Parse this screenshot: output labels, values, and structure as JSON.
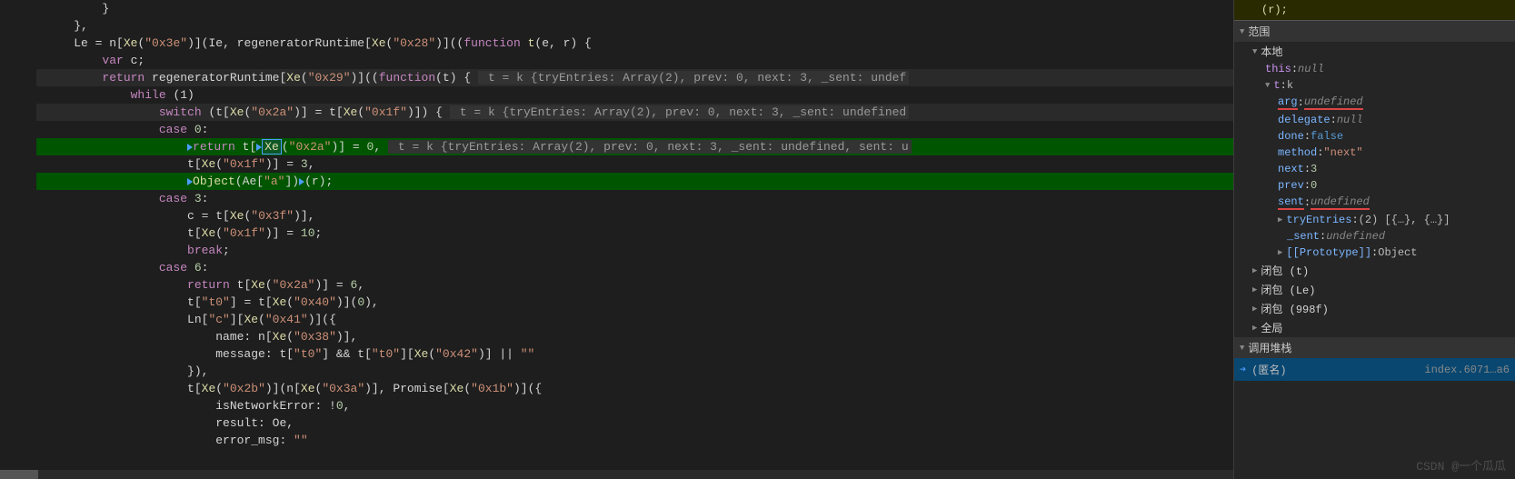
{
  "code": {
    "l0": "        }",
    "l1": "    },",
    "l2_pre": "    Le = n[",
    "l2_xe1": "Xe",
    "l2_s1": "\"0x3e\"",
    "l2_mid": ")](Ie, regeneratorRuntime[",
    "l2_xe2": "Xe",
    "l2_s2": "\"0x28\"",
    "l2_post": ")]((",
    "l2_fn": "function",
    "l2_fnname": " t",
    "l2_params": "(e, r) {",
    "l3_pre": "        ",
    "l3_var": "var",
    "l3_post": " c;",
    "l4_pre": "        ",
    "l4_ret": "return",
    "l4_mid": " regeneratorRuntime[",
    "l4_xe": "Xe",
    "l4_s": "\"0x29\"",
    "l4_post": ")]((",
    "l4_fn": "function",
    "l4_params": "(t) {",
    "l4_inline": " t = k {tryEntries: Array(2), prev: 0, next: 3, _sent: undef",
    "l5_pre": "            ",
    "l5_while": "while",
    "l5_cond": " (1)",
    "l6_pre": "                ",
    "l6_switch": "switch",
    "l6_cond_a": " (t[",
    "l6_xe1": "Xe",
    "l6_s1": "\"0x2a\"",
    "l6_cond_b": ")] = t[",
    "l6_xe2": "Xe",
    "l6_s2": "\"0x1f\"",
    "l6_cond_c": ")]) {",
    "l6_inline": " t = k {tryEntries: Array(2), prev: 0, next: 3, _sent: undefined",
    "l7_pre": "                ",
    "l7_case": "case",
    "l7_num": " 0",
    "l7_post": ":",
    "l8_pre": "                    ",
    "l8_ret": "return",
    "l8_mid_a": " t[",
    "l8_xe": "Xe",
    "l8_s": "\"0x2a\"",
    "l8_mid_b": ")] = ",
    "l8_val": "0",
    "l8_post": ",",
    "l8_inline": " t = k {tryEntries: Array(2), prev: 0, next: 3, _sent: undefined, sent: u",
    "l9_pre": "                    t[",
    "l9_xe": "Xe",
    "l9_s": "\"0x1f\"",
    "l9_mid": ")] = ",
    "l9_val": "3",
    "l9_post": ",",
    "l10_pre": "                    ",
    "l10_obj": "Object",
    "l10_mid_a": "(Ae[",
    "l10_s": "\"a\"",
    "l10_mid_b": "])",
    "l10_post": "(r);",
    "l11_pre": "                ",
    "l11_case": "case",
    "l11_num": " 3",
    "l11_post": ":",
    "l12": "                    c = t[Xe(\"0x3f\")],",
    "l12_pre": "                    c = t[",
    "l12_xe": "Xe",
    "l12_s": "\"0x3f\"",
    "l12_post": ")],",
    "l13_pre": "                    t[",
    "l13_xe": "Xe",
    "l13_s": "\"0x1f\"",
    "l13_mid": ")] = ",
    "l13_val": "10",
    "l13_post": ";",
    "l14_pre": "                    ",
    "l14_break": "break",
    "l14_post": ";",
    "l15_pre": "                ",
    "l15_case": "case",
    "l15_num": " 6",
    "l15_post": ":",
    "l16_pre": "                    ",
    "l16_ret": "return",
    "l16_mid_a": " t[",
    "l16_xe": "Xe",
    "l16_s": "\"0x2a\"",
    "l16_mid_b": ")] = ",
    "l16_val": "6",
    "l16_post": ",",
    "l17_pre": "                    t[",
    "l17_s1": "\"t0\"",
    "l17_mid_a": "] = t[",
    "l17_xe": "Xe",
    "l17_s2": "\"0x40\"",
    "l17_mid_b": ")](",
    "l17_val": "0",
    "l17_post": "),",
    "l18_pre": "                    Ln[",
    "l18_s1": "\"c\"",
    "l18_mid_a": "][",
    "l18_xe": "Xe",
    "l18_s2": "\"0x41\"",
    "l18_post": ")]({",
    "l19_pre": "                        name: n[",
    "l19_xe": "Xe",
    "l19_s": "\"0x38\"",
    "l19_post": ")],",
    "l20_pre": "                        message: t[",
    "l20_s1": "\"t0\"",
    "l20_mid_a": "] && t[",
    "l20_s2": "\"t0\"",
    "l20_mid_b": "][",
    "l20_xe": "Xe",
    "l20_s3": "\"0x42\"",
    "l20_mid_c": ")] || ",
    "l20_empty": "\"\"",
    "l21": "                    }),",
    "l22_pre": "                    t[",
    "l22_xe1": "Xe",
    "l22_s1": "\"0x2b\"",
    "l22_mid_a": ")](n[",
    "l22_xe2": "Xe",
    "l22_s2": "\"0x3a\"",
    "l22_mid_b": ")], Promise[",
    "l22_xe3": "Xe",
    "l22_s3": "\"0x1b\"",
    "l22_post": ")]({",
    "l23_pre": "                        isNetworkError: !",
    "l23_val": "0",
    "l23_post": ",",
    "l24": "                        result: Oe,",
    "l25_pre": "                        error_msg: ",
    "l25_s": "\"\""
  },
  "top_context": "(r);",
  "scope": {
    "header": "范围",
    "local": "本地",
    "this_key": "this",
    "this_val": "null",
    "t_key": "t",
    "t_val": "k",
    "props": {
      "arg_k": "arg",
      "arg_v": "undefined",
      "delegate_k": "delegate",
      "delegate_v": "null",
      "done_k": "done",
      "done_v": "false",
      "method_k": "method",
      "method_v": "\"next\"",
      "next_k": "next",
      "next_v": "3",
      "prev_k": "prev",
      "prev_v": "0",
      "sent_k": "sent",
      "sent_v": "undefined",
      "tryEntries_k": "tryEntries",
      "tryEntries_v": "(2) [{…}, {…}]",
      "_sent_k": "_sent",
      "_sent_v": "undefined",
      "proto_k": "[[Prototype]]",
      "proto_v": "Object"
    },
    "closure1": "闭包 (t)",
    "closure2": "闭包 (Le)",
    "closure3": "闭包 (998f)",
    "global": "全局"
  },
  "callstack": {
    "header": "调用堆栈",
    "item1": "(匿名)",
    "item1_right": "index.6071…a6"
  },
  "watermark": "CSDN @一个瓜瓜"
}
